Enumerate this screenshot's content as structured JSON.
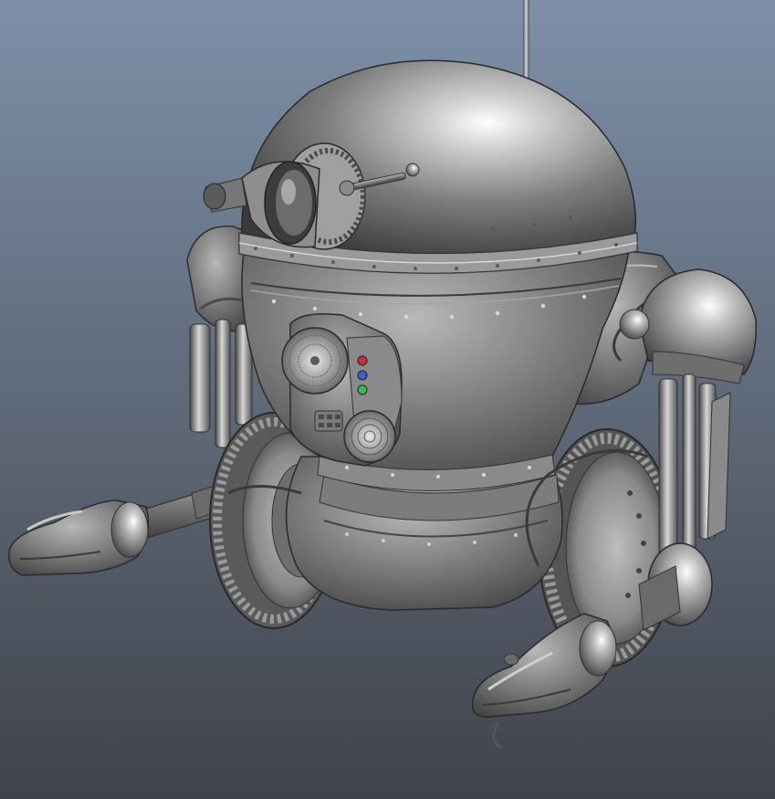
{
  "viewport": {
    "background_top": "#7d90a8",
    "background_bottom": "#40434b",
    "model_color": "#8a8a8a"
  },
  "indicator_lights": [
    {
      "name": "red-light",
      "color": "#d03030"
    },
    {
      "name": "blue-light",
      "color": "#3a5ed8"
    },
    {
      "name": "green-light",
      "color": "#2ec048"
    }
  ]
}
